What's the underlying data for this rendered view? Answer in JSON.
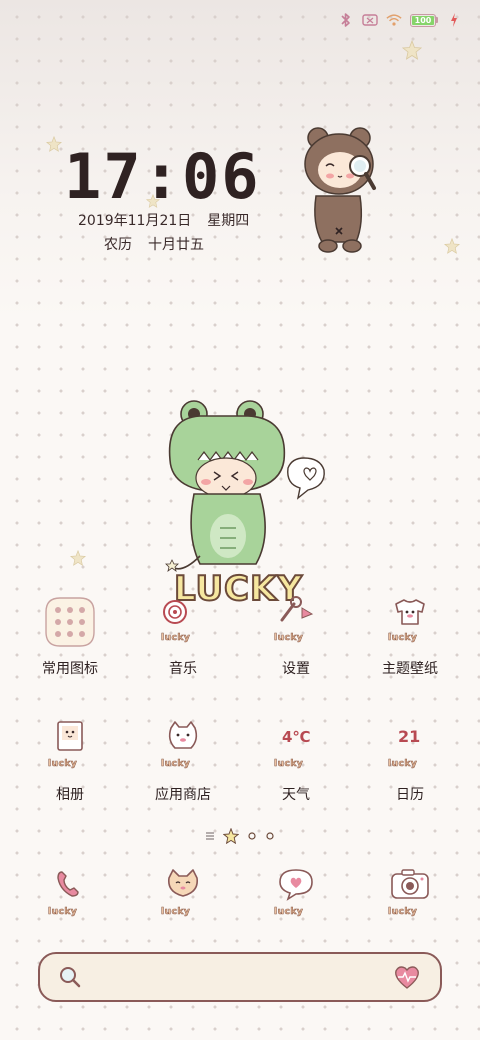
{
  "status_bar": {
    "battery_level": "100",
    "battery_fraction": 1.0,
    "icons": [
      "bluetooth-icon",
      "sim-icon",
      "wifi-icon",
      "battery-icon",
      "charging-icon"
    ]
  },
  "lockscreen": {
    "time": "17:06",
    "date": "2019年11月21日",
    "weekday": "星期四",
    "lunar_label": "农历",
    "lunar_date": "十月廿五"
  },
  "decorations": {
    "dino_badge": "LUCKY",
    "icon_badge": "lucky"
  },
  "apps": [
    {
      "label": "常用图标",
      "icon": "folder-icon"
    },
    {
      "label": "音乐",
      "icon": "music-icon"
    },
    {
      "label": "设置",
      "icon": "settings-icon"
    },
    {
      "label": "主题壁纸",
      "icon": "theme-icon"
    },
    {
      "label": "相册",
      "icon": "gallery-icon"
    },
    {
      "label": "应用商店",
      "icon": "app-store-icon"
    },
    {
      "label": "天气",
      "icon": "weather-icon",
      "value": "4℃"
    },
    {
      "label": "日历",
      "icon": "calendar-icon",
      "value": "21"
    }
  ],
  "dock": [
    {
      "icon": "phone-icon"
    },
    {
      "icon": "contacts-icon"
    },
    {
      "icon": "messages-icon"
    },
    {
      "icon": "camera-icon"
    }
  ],
  "page_indicator": {
    "pages": 4,
    "current": 1
  },
  "search": {
    "icon": "search-icon",
    "assistant_icon": "heart-assistant-icon"
  },
  "colors": {
    "accent": "#8a5a58",
    "text": "#2f2222",
    "lucky_fill": "#f3c9a6",
    "pink": "#e88aa0"
  }
}
